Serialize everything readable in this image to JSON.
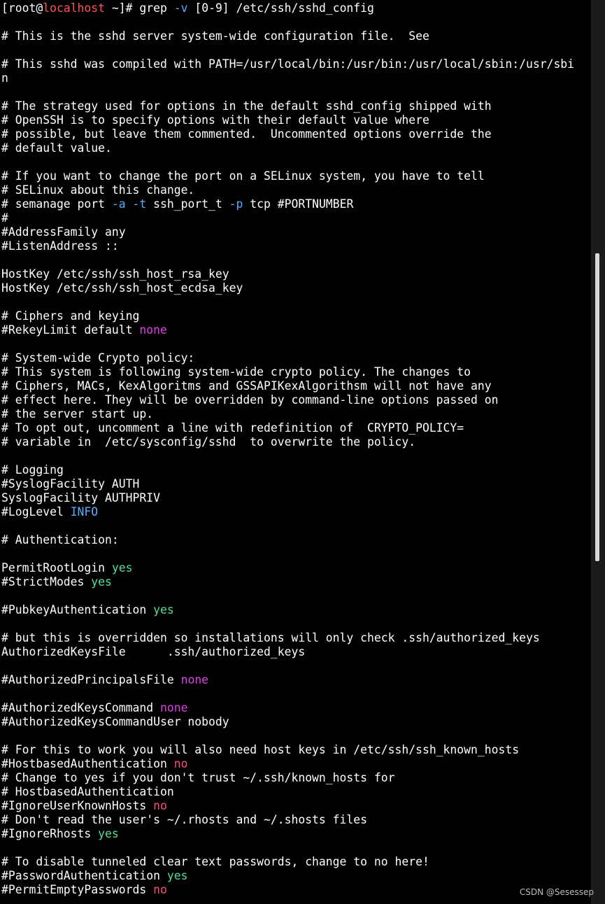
{
  "colors": {
    "background": "#000000",
    "default": "#ffffff",
    "host": "#ff5555",
    "option": "#54b0ff",
    "yes": "#4ee29a",
    "no": "#ff4f7a",
    "none": "#e040e8",
    "info": "#54b0ff"
  },
  "watermark": "CSDN @Sesessep",
  "lines": [
    [
      {
        "t": "[root@",
        "c": "default"
      },
      {
        "t": "localhost",
        "c": "host"
      },
      {
        "t": " ~]# grep ",
        "c": "default"
      },
      {
        "t": "-v",
        "c": "option"
      },
      {
        "t": " [0-9] /etc/ssh/sshd_config",
        "c": "default"
      }
    ],
    [],
    [
      {
        "t": "# This is the sshd server system-wide configuration file.  See",
        "c": "default"
      }
    ],
    [],
    [
      {
        "t": "# This sshd was compiled with PATH=/usr/local/bin:/usr/bin:/usr/local/sbin:/usr/sbi",
        "c": "default"
      }
    ],
    [
      {
        "t": "n",
        "c": "default"
      }
    ],
    [],
    [
      {
        "t": "# The strategy used for options in the default sshd_config shipped with",
        "c": "default"
      }
    ],
    [
      {
        "t": "# OpenSSH is to specify options with their default value where",
        "c": "default"
      }
    ],
    [
      {
        "t": "# possible, but leave them commented.  Uncommented options override the",
        "c": "default"
      }
    ],
    [
      {
        "t": "# default value.",
        "c": "default"
      }
    ],
    [],
    [
      {
        "t": "# If you want to change the port on a SELinux system, you have to tell",
        "c": "default"
      }
    ],
    [
      {
        "t": "# SELinux about this change.",
        "c": "default"
      }
    ],
    [
      {
        "t": "# semanage port ",
        "c": "default"
      },
      {
        "t": "-a",
        "c": "option"
      },
      {
        "t": " ",
        "c": "default"
      },
      {
        "t": "-t",
        "c": "option"
      },
      {
        "t": " ssh_port_t ",
        "c": "default"
      },
      {
        "t": "-p",
        "c": "option"
      },
      {
        "t": " tcp #PORTNUMBER",
        "c": "default"
      }
    ],
    [
      {
        "t": "#",
        "c": "default"
      }
    ],
    [
      {
        "t": "#AddressFamily any",
        "c": "default"
      }
    ],
    [
      {
        "t": "#ListenAddress ::",
        "c": "default"
      }
    ],
    [],
    [
      {
        "t": "HostKey /etc/ssh/ssh_host_rsa_key",
        "c": "default"
      }
    ],
    [
      {
        "t": "HostKey /etc/ssh/ssh_host_ecdsa_key",
        "c": "default"
      }
    ],
    [],
    [
      {
        "t": "# Ciphers and keying",
        "c": "default"
      }
    ],
    [
      {
        "t": "#RekeyLimit default ",
        "c": "default"
      },
      {
        "t": "none",
        "c": "none"
      }
    ],
    [],
    [
      {
        "t": "# System-wide Crypto policy:",
        "c": "default"
      }
    ],
    [
      {
        "t": "# This system is following system-wide crypto policy. The changes to",
        "c": "default"
      }
    ],
    [
      {
        "t": "# Ciphers, MACs, KexAlgoritms and GSSAPIKexAlgorithsm will not have any",
        "c": "default"
      }
    ],
    [
      {
        "t": "# effect here. They will be overridden by command-line options passed on",
        "c": "default"
      }
    ],
    [
      {
        "t": "# the server start up.",
        "c": "default"
      }
    ],
    [
      {
        "t": "# To opt out, uncomment a line with redefinition of  CRYPTO_POLICY=",
        "c": "default"
      }
    ],
    [
      {
        "t": "# variable in  /etc/sysconfig/sshd  to overwrite the policy.",
        "c": "default"
      }
    ],
    [],
    [
      {
        "t": "# Logging",
        "c": "default"
      }
    ],
    [
      {
        "t": "#SyslogFacility AUTH",
        "c": "default"
      }
    ],
    [
      {
        "t": "SyslogFacility AUTHPRIV",
        "c": "default"
      }
    ],
    [
      {
        "t": "#LogLevel ",
        "c": "default"
      },
      {
        "t": "INFO",
        "c": "info"
      }
    ],
    [],
    [
      {
        "t": "# Authentication:",
        "c": "default"
      }
    ],
    [],
    [
      {
        "t": "PermitRootLogin ",
        "c": "default"
      },
      {
        "t": "yes",
        "c": "yes"
      }
    ],
    [
      {
        "t": "#StrictModes ",
        "c": "default"
      },
      {
        "t": "yes",
        "c": "yes"
      }
    ],
    [],
    [
      {
        "t": "#PubkeyAuthentication ",
        "c": "default"
      },
      {
        "t": "yes",
        "c": "yes"
      }
    ],
    [],
    [
      {
        "t": "# but this is overridden so installations will only check .ssh/authorized_keys",
        "c": "default"
      }
    ],
    [
      {
        "t": "AuthorizedKeysFile      .ssh/authorized_keys",
        "c": "default"
      }
    ],
    [],
    [
      {
        "t": "#AuthorizedPrincipalsFile ",
        "c": "default"
      },
      {
        "t": "none",
        "c": "none"
      }
    ],
    [],
    [
      {
        "t": "#AuthorizedKeysCommand ",
        "c": "default"
      },
      {
        "t": "none",
        "c": "none"
      }
    ],
    [
      {
        "t": "#AuthorizedKeysCommandUser nobody",
        "c": "default"
      }
    ],
    [],
    [
      {
        "t": "# For this to work you will also need host keys in /etc/ssh/ssh_known_hosts",
        "c": "default"
      }
    ],
    [
      {
        "t": "#HostbasedAuthentication ",
        "c": "default"
      },
      {
        "t": "no",
        "c": "no"
      }
    ],
    [
      {
        "t": "# Change to yes if you don't trust ~/.ssh/known_hosts for",
        "c": "default"
      }
    ],
    [
      {
        "t": "# HostbasedAuthentication",
        "c": "default"
      }
    ],
    [
      {
        "t": "#IgnoreUserKnownHosts ",
        "c": "default"
      },
      {
        "t": "no",
        "c": "no"
      }
    ],
    [
      {
        "t": "# Don't read the user's ~/.rhosts and ~/.shosts files",
        "c": "default"
      }
    ],
    [
      {
        "t": "#IgnoreRhosts ",
        "c": "default"
      },
      {
        "t": "yes",
        "c": "yes"
      }
    ],
    [],
    [
      {
        "t": "# To disable tunneled clear text passwords, change to no here!",
        "c": "default"
      }
    ],
    [
      {
        "t": "#PasswordAuthentication ",
        "c": "default"
      },
      {
        "t": "yes",
        "c": "yes"
      }
    ],
    [
      {
        "t": "#PermitEmptyPasswords ",
        "c": "default"
      },
      {
        "t": "no",
        "c": "no"
      }
    ]
  ]
}
